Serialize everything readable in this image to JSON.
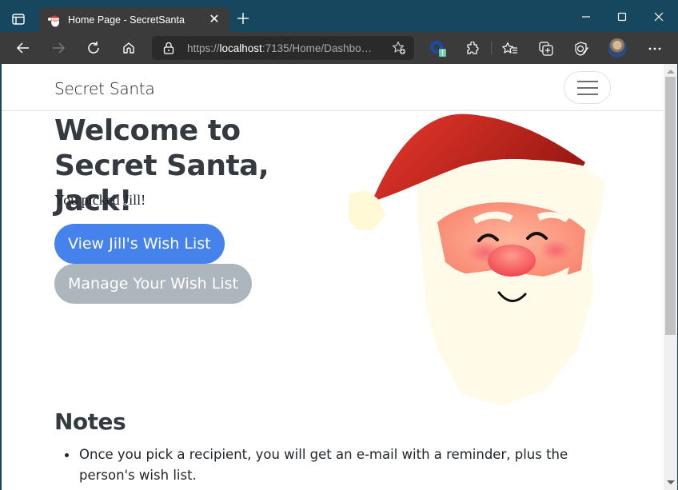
{
  "browser": {
    "tab": {
      "title": "Home Page - SecretSanta",
      "favicon": "santa-favicon"
    },
    "new_tab_label": "+",
    "address": {
      "scheme": "https://",
      "host": "localhost",
      "rest": ":7135/Home/Dashbo…"
    },
    "toolbar_icons": [
      "back-icon",
      "forward-icon",
      "refresh-icon",
      "home-icon",
      "lock-icon",
      "add-favorite-icon",
      "extension-badge-icon",
      "extensions-icon",
      "favorites-icon",
      "collections-icon",
      "browser-essentials-icon",
      "profile-avatar",
      "more-icon"
    ],
    "window_controls": [
      "minimize",
      "maximize",
      "close"
    ]
  },
  "page": {
    "navbar": {
      "brand": "Secret Santa",
      "toggler": "menu-toggle"
    },
    "hero": {
      "title": "Welcome to Secret Santa, Jack!",
      "subtitle": "You picked Jill!"
    },
    "buttons": {
      "view_wishlist": "View Jill's Wish List",
      "manage_wishlist": "Manage Your Wish List"
    },
    "notes": {
      "title": "Notes",
      "items": [
        "Once you pick a recipient, you will get an e-mail with a reminder, plus the person's wish list."
      ]
    },
    "colors": {
      "primary": "#4582ec",
      "secondary": "#adb5bd",
      "heading": "#343a40",
      "browser_frame": "#16475f"
    }
  }
}
